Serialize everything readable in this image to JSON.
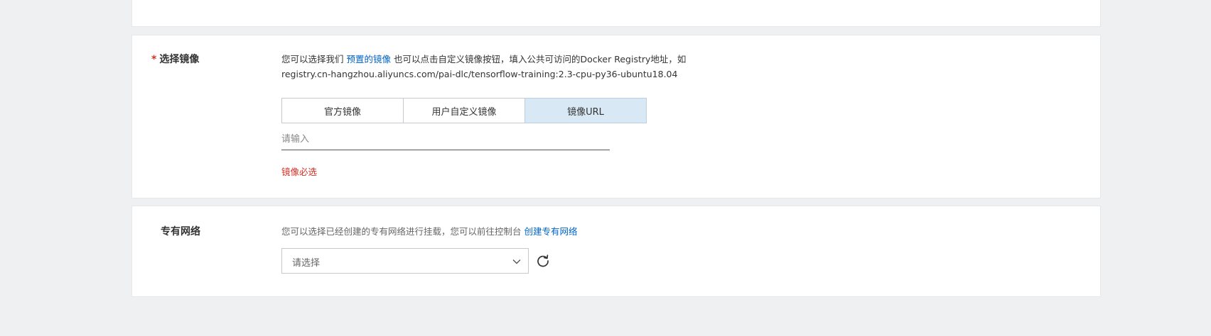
{
  "image_section": {
    "required_mark": "*",
    "label": "选择镜像",
    "description_prefix": "您可以选择我们 ",
    "description_link": "预置的镜像",
    "description_suffix": " 也可以点击自定义镜像按钮，填入公共可访问的Docker Registry地址，如",
    "description_example": "registry.cn-hangzhou.aliyuncs.com/pai-dlc/tensorflow-training:2.3-cpu-py36-ubuntu18.04",
    "tabs": [
      {
        "label": "官方镜像",
        "active": false
      },
      {
        "label": "用户自定义镜像",
        "active": false
      },
      {
        "label": "镜像URL",
        "active": true
      }
    ],
    "url_input": {
      "placeholder": "请输入",
      "value": ""
    },
    "error": "镜像必选"
  },
  "vpc_section": {
    "label": "专有网络",
    "description": "您可以选择已经创建的专有网络进行挂载，您可以前往控制台 ",
    "description_link": "创建专有网络",
    "select": {
      "placeholder": "请选择"
    },
    "icons": {
      "dropdown": "chevron-down-icon",
      "refresh": "refresh-icon"
    }
  },
  "colors": {
    "link": "#0064c8",
    "error": "#d93026",
    "active_tab": "#d8e8f5",
    "background": "#eff0f2"
  }
}
